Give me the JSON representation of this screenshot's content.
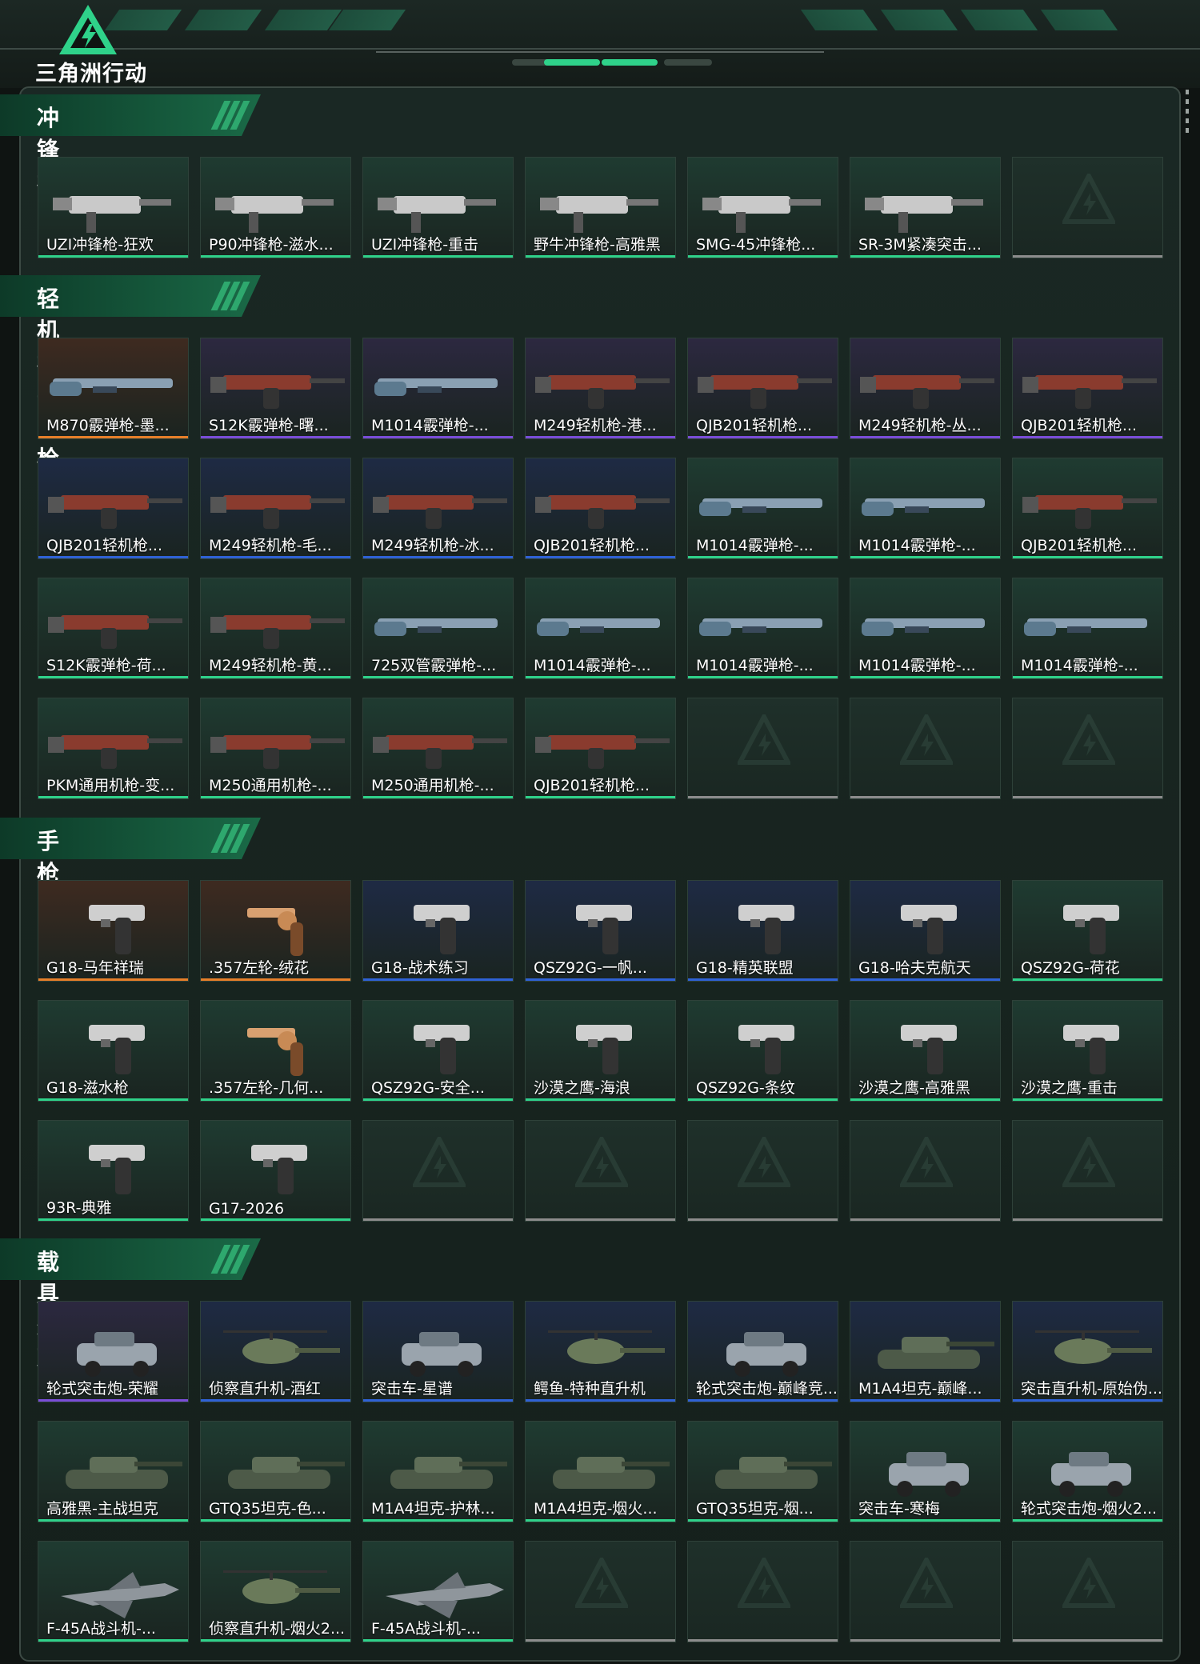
{
  "header": {
    "logo_text": "三角洲行动",
    "logo_icon": "delta-triangle-logo-icon"
  },
  "colors": {
    "bar_green": "#2fd28a",
    "bar_purple": "#7a4dd8",
    "bar_orange": "#e77f2a",
    "bar_blue": "#2f62d6",
    "bar_grey": "#8c8c8c",
    "bg_green_card": "#1f3b31",
    "bg_purple_card": "#2c2840",
    "bg_orange_card": "#3e2a20",
    "bg_blue_card": "#1e2a44"
  },
  "sections": [
    {
      "title": "冲锋枪",
      "rows": [
        [
          {
            "label": "UZI冲锋枪-狂欢",
            "rarity": "green",
            "kind": "smg"
          },
          {
            "label": "P90冲锋枪-滋水...",
            "rarity": "green",
            "kind": "smg"
          },
          {
            "label": "UZI冲锋枪-重击",
            "rarity": "green",
            "kind": "smg"
          },
          {
            "label": "野牛冲锋枪-高雅黑",
            "rarity": "green",
            "kind": "smg"
          },
          {
            "label": "SMG-45冲锋枪...",
            "rarity": "green",
            "kind": "smg"
          },
          {
            "label": "SR-3M紧凑突击...",
            "rarity": "green",
            "kind": "smg"
          },
          null
        ]
      ]
    },
    {
      "title": "轻机枪/霰弹枪",
      "rows": [
        [
          {
            "label": "M870霰弹枪-墨...",
            "rarity": "orange",
            "kind": "shotgun"
          },
          {
            "label": "S12K霰弹枪-曙...",
            "rarity": "purple",
            "kind": "lmg"
          },
          {
            "label": "M1014霰弹枪-...",
            "rarity": "purple",
            "kind": "shotgun"
          },
          {
            "label": "M249轻机枪-港...",
            "rarity": "purple",
            "kind": "lmg"
          },
          {
            "label": "QJB201轻机枪...",
            "rarity": "purple",
            "kind": "lmg"
          },
          {
            "label": "M249轻机枪-丛...",
            "rarity": "purple",
            "kind": "lmg"
          },
          {
            "label": "QJB201轻机枪...",
            "rarity": "purple",
            "kind": "lmg"
          }
        ],
        [
          {
            "label": "QJB201轻机枪...",
            "rarity": "blue",
            "kind": "lmg"
          },
          {
            "label": "M249轻机枪-毛...",
            "rarity": "blue",
            "kind": "lmg"
          },
          {
            "label": "M249轻机枪-冰...",
            "rarity": "blue",
            "kind": "lmg"
          },
          {
            "label": "QJB201轻机枪...",
            "rarity": "blue",
            "kind": "lmg"
          },
          {
            "label": "M1014霰弹枪-...",
            "rarity": "green",
            "kind": "shotgun"
          },
          {
            "label": "M1014霰弹枪-...",
            "rarity": "green",
            "kind": "shotgun"
          },
          {
            "label": "QJB201轻机枪...",
            "rarity": "green",
            "kind": "lmg"
          }
        ],
        [
          {
            "label": "S12K霰弹枪-荷...",
            "rarity": "green",
            "kind": "lmg"
          },
          {
            "label": "M249轻机枪-黄...",
            "rarity": "green",
            "kind": "lmg"
          },
          {
            "label": "725双管霰弹枪-...",
            "rarity": "green",
            "kind": "shotgun"
          },
          {
            "label": "M1014霰弹枪-...",
            "rarity": "green",
            "kind": "shotgun"
          },
          {
            "label": "M1014霰弹枪-...",
            "rarity": "green",
            "kind": "shotgun"
          },
          {
            "label": "M1014霰弹枪-...",
            "rarity": "green",
            "kind": "shotgun"
          },
          {
            "label": "M1014霰弹枪-...",
            "rarity": "green",
            "kind": "shotgun"
          }
        ],
        [
          {
            "label": "PKM通用机枪-变...",
            "rarity": "green",
            "kind": "lmg"
          },
          {
            "label": "M250通用机枪-...",
            "rarity": "green",
            "kind": "lmg"
          },
          {
            "label": "M250通用机枪-...",
            "rarity": "green",
            "kind": "lmg"
          },
          {
            "label": "QJB201轻机枪...",
            "rarity": "green",
            "kind": "lmg"
          },
          null,
          null,
          null
        ]
      ]
    },
    {
      "title": "手枪",
      "rows": [
        [
          {
            "label": "G18-马年祥瑞",
            "rarity": "orange",
            "kind": "pistol"
          },
          {
            "label": ".357左轮-绒花",
            "rarity": "orange",
            "kind": "revolver"
          },
          {
            "label": "G18-战术练习",
            "rarity": "blue",
            "kind": "pistol"
          },
          {
            "label": "QSZ92G-一帆...",
            "rarity": "blue",
            "kind": "pistol"
          },
          {
            "label": "G18-精英联盟",
            "rarity": "blue",
            "kind": "pistol"
          },
          {
            "label": "G18-哈夫克航天",
            "rarity": "blue",
            "kind": "pistol"
          },
          {
            "label": "QSZ92G-荷花",
            "rarity": "green",
            "kind": "pistol"
          }
        ],
        [
          {
            "label": "G18-滋水枪",
            "rarity": "green",
            "kind": "pistol"
          },
          {
            "label": ".357左轮-几何...",
            "rarity": "green",
            "kind": "revolver"
          },
          {
            "label": "QSZ92G-安全...",
            "rarity": "green",
            "kind": "pistol"
          },
          {
            "label": "沙漠之鹰-海浪",
            "rarity": "green",
            "kind": "pistol"
          },
          {
            "label": "QSZ92G-条纹",
            "rarity": "green",
            "kind": "pistol"
          },
          {
            "label": "沙漠之鹰-高雅黑",
            "rarity": "green",
            "kind": "pistol"
          },
          {
            "label": "沙漠之鹰-重击",
            "rarity": "green",
            "kind": "pistol"
          }
        ],
        [
          {
            "label": "93R-典雅",
            "rarity": "green",
            "kind": "pistol"
          },
          {
            "label": "G17-2026",
            "rarity": "green",
            "kind": "pistol"
          },
          null,
          null,
          null,
          null,
          null
        ]
      ]
    },
    {
      "title": "载具外观",
      "rows": [
        [
          {
            "label": "轮式突击炮-荣耀",
            "rarity": "purple",
            "kind": "car"
          },
          {
            "label": "侦察直升机-酒红",
            "rarity": "blue",
            "kind": "heli"
          },
          {
            "label": "突击车-星谱",
            "rarity": "blue",
            "kind": "car"
          },
          {
            "label": "鳄鱼-特种直升机",
            "rarity": "blue",
            "kind": "heli"
          },
          {
            "label": "轮式突击炮-巅峰竞...",
            "rarity": "blue",
            "kind": "car"
          },
          {
            "label": "M1A4坦克-巅峰...",
            "rarity": "blue",
            "kind": "tank"
          },
          {
            "label": "突击直升机-原始伪...",
            "rarity": "blue",
            "kind": "heli"
          }
        ],
        [
          {
            "label": "高雅黑-主战坦克",
            "rarity": "green",
            "kind": "tank"
          },
          {
            "label": "GTQ35坦克-色...",
            "rarity": "green",
            "kind": "tank"
          },
          {
            "label": "M1A4坦克-护林...",
            "rarity": "green",
            "kind": "tank"
          },
          {
            "label": "M1A4坦克-烟火...",
            "rarity": "green",
            "kind": "tank"
          },
          {
            "label": "GTQ35坦克-烟...",
            "rarity": "green",
            "kind": "tank"
          },
          {
            "label": "突击车-寒梅",
            "rarity": "green",
            "kind": "car"
          },
          {
            "label": "轮式突击炮-烟火2...",
            "rarity": "green",
            "kind": "car"
          }
        ],
        [
          {
            "label": "F-45A战斗机-...",
            "rarity": "green",
            "kind": "jet"
          },
          {
            "label": "侦察直升机-烟火2...",
            "rarity": "green",
            "kind": "heli"
          },
          {
            "label": "F-45A战斗机-...",
            "rarity": "green",
            "kind": "jet"
          },
          null,
          null,
          null,
          null
        ]
      ]
    }
  ]
}
